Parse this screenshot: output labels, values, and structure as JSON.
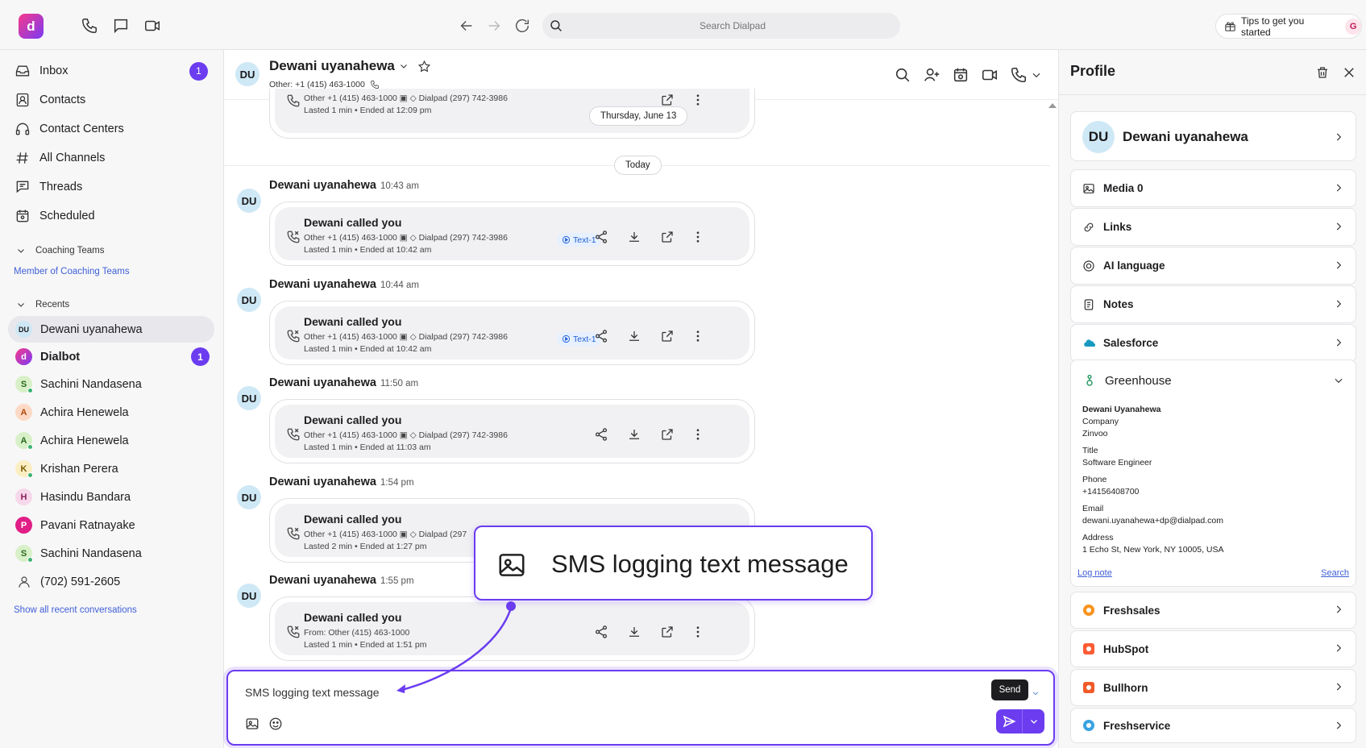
{
  "topbar": {
    "logo_glyph": "d",
    "search_placeholder": "Search Dialpad",
    "tips_label": "Tips to get you started",
    "user_initial": "G"
  },
  "sidebar": {
    "nav": [
      {
        "label": "Inbox",
        "icon": "inbox-icon",
        "badge": "1"
      },
      {
        "label": "Contacts",
        "icon": "contacts-icon"
      },
      {
        "label": "Contact Centers",
        "icon": "headset-icon"
      },
      {
        "label": "All Channels",
        "icon": "channels-icon"
      },
      {
        "label": "Threads",
        "icon": "threads-icon"
      },
      {
        "label": "Scheduled",
        "icon": "calendar-icon"
      }
    ],
    "coaching_header": "Coaching Teams",
    "coaching_link": "Member of Coaching Teams",
    "recents_header": "Recents",
    "recents": [
      {
        "initials": "DU",
        "name": "Dewani uyanahewa"
      },
      {
        "initials": "d",
        "name": "Dialbot",
        "badge": "1"
      },
      {
        "initials": "S",
        "name": "Sachini Nandasena"
      },
      {
        "initials": "A",
        "name": "Achira Henewela"
      },
      {
        "initials": "A",
        "name": "Achira Henewela"
      },
      {
        "initials": "K",
        "name": "Krishan Perera"
      },
      {
        "initials": "H",
        "name": "Hasindu Bandara"
      },
      {
        "initials": "P",
        "name": "Pavani Ratnayake"
      },
      {
        "initials": "S",
        "name": "Sachini Nandasena"
      },
      {
        "initials": "",
        "name": "(702) 591-2605"
      }
    ],
    "show_all": "Show all recent conversations"
  },
  "conversation": {
    "initials": "DU",
    "name": "Dewani uyanahewa",
    "subtitle": "Other: +1 (415) 463-1000",
    "top_card": {
      "sub": "Other +1 (415) 463-1000 ▣ ◇ Dialpad (297) 742-3986",
      "sub2": "Lasted 1 min • Ended at 12:09 pm"
    },
    "date_pill": "Thursday, June 13",
    "today_pill": "Today",
    "messages": [
      {
        "name": "Dewani uyanahewa",
        "time": "10:43 am",
        "title": "Dewani called you",
        "sub": "Other +1 (415) 463-1000 ▣ ◇ Dialpad (297) 742-3986",
        "sub2": "Lasted 1 min • Ended at 10:42 am",
        "tag": "Text-1"
      },
      {
        "name": "Dewani uyanahewa",
        "time": "10:44 am",
        "title": "Dewani called you",
        "sub": "Other +1 (415) 463-1000 ▣ ◇ Dialpad (297) 742-3986",
        "sub2": "Lasted 1 min • Ended at 10:42 am",
        "tag": "Text-1"
      },
      {
        "name": "Dewani uyanahewa",
        "time": "11:50 am",
        "title": "Dewani called you",
        "sub": "Other +1 (415) 463-1000 ▣ ◇ Dialpad (297) 742-3986",
        "sub2": "Lasted 1 min • Ended at 11:03 am",
        "tag": ""
      },
      {
        "name": "Dewani uyanahewa",
        "time": "1:54 pm",
        "title": "Dewani called you",
        "sub": "Other +1 (415) 463-1000 ▣ ◇ Dialpad (297",
        "sub2": "Lasted 2 min • Ended at 1:27 pm",
        "tag": ""
      },
      {
        "name": "Dewani uyanahewa",
        "time": "1:55 pm",
        "title": "Dewani called you",
        "sub": "From: Other (415) 463-1000",
        "sub2": "Lasted 1 min • Ended at 1:51 pm",
        "tag": ""
      }
    ]
  },
  "composer": {
    "text": "SMS logging text message",
    "send_tooltip": "Send"
  },
  "callout": {
    "text": "SMS logging text message"
  },
  "profile": {
    "title": "Profile",
    "contact_initials": "DU",
    "contact_name": "Dewani uyanahewa",
    "rows": [
      {
        "label": "Media 0",
        "icon": "image-icon"
      },
      {
        "label": "Links",
        "icon": "link-icon"
      },
      {
        "label": "AI language",
        "icon": "ai-language-icon"
      },
      {
        "label": "Notes",
        "icon": "notes-icon"
      },
      {
        "label": "Salesforce",
        "icon": "salesforce-icon"
      }
    ],
    "greenhouse": {
      "label": "Greenhouse",
      "person": "Dewani Uyanahewa",
      "company_label": "Company",
      "company": "Zinvoo",
      "title_label": "Title",
      "title": "Software Engineer",
      "phone_label": "Phone",
      "phone": "+14156408700",
      "email_label": "Email",
      "email": "dewani.uyanahewa+dp@dialpad.com",
      "address_label": "Address",
      "address": "1 Echo St, New York, NY 10005, USA",
      "log_note": "Log note",
      "search": "Search"
    },
    "integrations": [
      {
        "label": "Freshsales",
        "color": "#f7931e"
      },
      {
        "label": "HubSpot",
        "color": "#ff5c35"
      },
      {
        "label": "Bullhorn",
        "color": "#f15a29"
      },
      {
        "label": "Freshservice",
        "color": "#3aa3e3"
      }
    ]
  },
  "colors": {
    "accent": "#6b3cf0",
    "link": "#3f5fd6"
  }
}
